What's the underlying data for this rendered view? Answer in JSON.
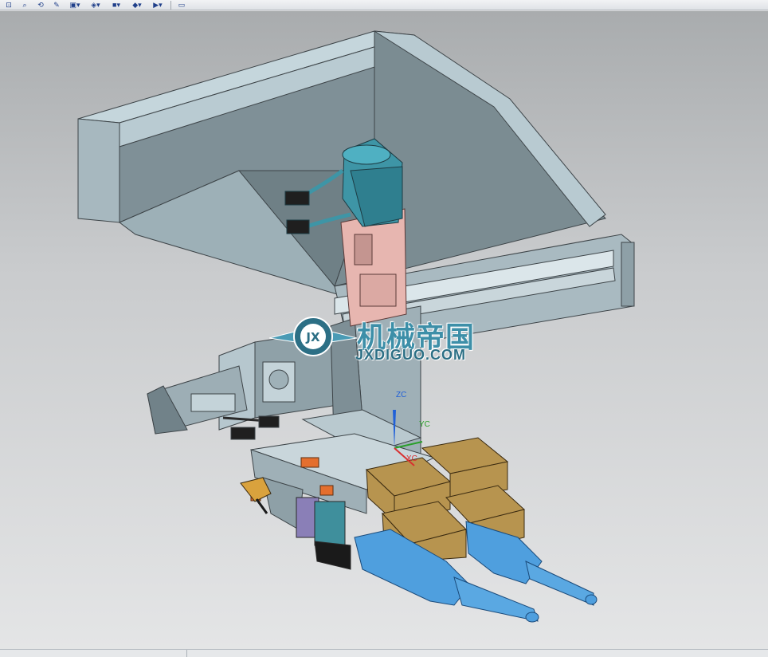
{
  "toolbar": {
    "buttons": [
      {
        "icon": "fit-view-icon",
        "glyph": "⊡"
      },
      {
        "icon": "zoom-icon",
        "glyph": "⌕"
      },
      {
        "icon": "rotate-icon",
        "glyph": "⟲"
      },
      {
        "icon": "pan-icon",
        "glyph": "✎"
      },
      {
        "icon": "view-orient-icon",
        "glyph": "▣▾"
      },
      {
        "icon": "render-style-icon",
        "glyph": "◈▾"
      },
      {
        "icon": "shaded-cube-icon",
        "glyph": "■▾"
      },
      {
        "icon": "section-view-icon",
        "glyph": "◆▾"
      },
      {
        "icon": "snap-icon",
        "glyph": "▶▾"
      },
      {
        "icon": "measure-icon",
        "glyph": "▭"
      }
    ]
  },
  "watermark": {
    "title": "机械帝国",
    "url": "JXDIGUO.COM",
    "emblem": "JX"
  },
  "axes": {
    "z": "ZC",
    "y": "YC",
    "x": "XC"
  },
  "colors": {
    "frame": "#a9b6bd",
    "motor": "#3e95a6",
    "pink_bracket": "#e7b6b0",
    "cylinder": "#b7944f",
    "gun": "#4f9fde"
  }
}
